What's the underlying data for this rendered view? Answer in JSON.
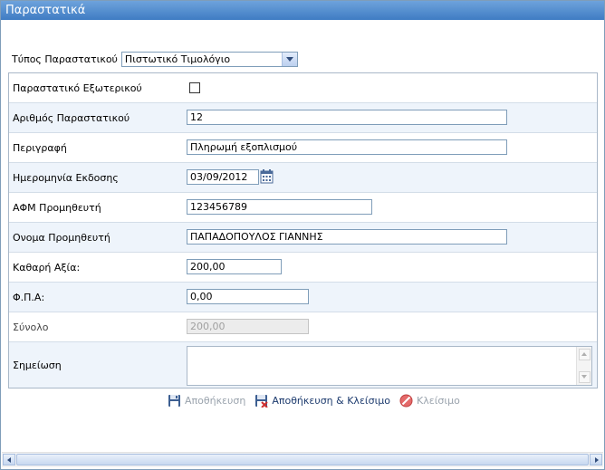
{
  "window": {
    "title": "Παραστατικά"
  },
  "doc_type": {
    "label": "Τύπος Παραστατικού",
    "value": "Πιστωτικό Τιμολόγιο"
  },
  "fields": {
    "external": {
      "label": "Παραστατικό Εξωτερικού",
      "checked": false
    },
    "number": {
      "label": "Αριθμός Παραστατικού",
      "value": "12"
    },
    "description": {
      "label": "Περιγραφή",
      "value": "Πληρωμή εξοπλισμού"
    },
    "issue_date": {
      "label": "Ημερομηνία Εκδοσης",
      "value": "03/09/2012"
    },
    "supplier_vat": {
      "label": "ΑΦΜ Προμηθευτή",
      "value": "123456789"
    },
    "supplier_name": {
      "label": "Ονομα Προμηθευτή",
      "value": "ΠΑΠΑΔΟΠΟΥΛΟΣ ΓΙΑΝΝΗΣ"
    },
    "net_value": {
      "label": "Καθαρή Αξία:",
      "value": "200,00"
    },
    "vat": {
      "label": "Φ.Π.Α:",
      "value": "0,00"
    },
    "total": {
      "label": "Σύνολο",
      "value": "200,00"
    },
    "note": {
      "label": "Σημείωση",
      "value": ""
    }
  },
  "actions": {
    "save": "Αποθήκευση",
    "save_close": "Αποθήκευση & Κλείσιμο",
    "close": "Κλείσιμο"
  },
  "colors": {
    "title_bar": "#4a86cc",
    "row_alt": "#eef4fb",
    "close_icon": "#e05050"
  }
}
